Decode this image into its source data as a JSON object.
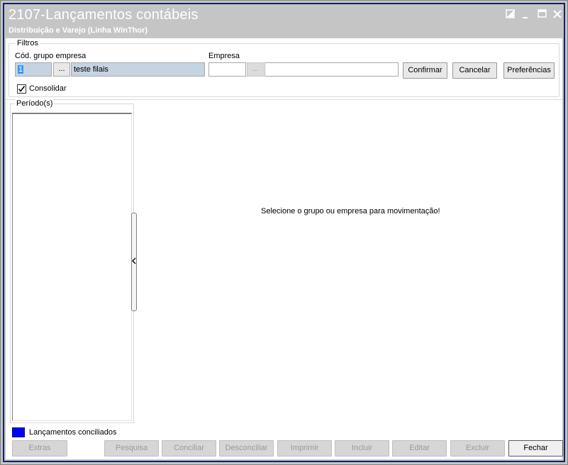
{
  "window": {
    "title": "2107-Lançamentos contábeis",
    "subtitle": "Distribuição e Varejo (Linha WinThor)"
  },
  "titlebar_buttons": [
    "restore-icon",
    "minimize-icon",
    "maximize-icon",
    "close-icon"
  ],
  "filters": {
    "legend": "Filtros",
    "grupo_label": "Cód. grupo empresa",
    "grupo_code": "1",
    "grupo_lookup_label": "...",
    "grupo_name": "teste filais",
    "empresa_label": "Empresa",
    "empresa_code": "",
    "empresa_lookup_label": "...",
    "empresa_name": "",
    "consolidar_label": "Consolidar",
    "consolidar_checked": true,
    "buttons": {
      "confirmar": "Confirmar",
      "cancelar": "Cancelar",
      "preferencias": "Preferências"
    }
  },
  "periodos": {
    "legend": "Período(s)"
  },
  "message": "Selecione o grupo ou empresa para movimentação!",
  "legend": {
    "color": "#0000ff",
    "label": "Lançamentos conciliados"
  },
  "actions": {
    "extras": "Extras",
    "pesquisa": "Pesquisa",
    "conciliar": "Conciliar",
    "desconciliar": "Desconciliar",
    "imprimir": "Imprimir",
    "incluir": "Incluir",
    "editar": "Editar",
    "excluir": "Excluir",
    "fechar": "Fechar"
  },
  "colors": {
    "titlebar": "#c5c5c5",
    "frame": "#0a246a",
    "selected_field": "#c6d3e0"
  }
}
